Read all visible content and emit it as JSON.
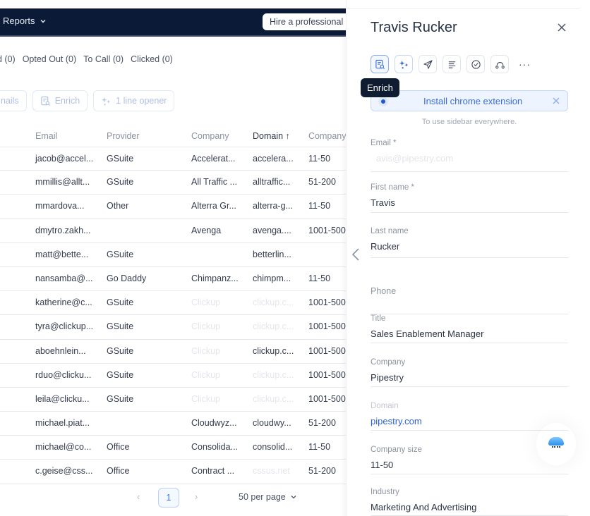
{
  "nav": {
    "reports_label": "Reports",
    "hire_button": "Hire a professional"
  },
  "filters": [
    {
      "label": "d (0)"
    },
    {
      "label": "Opted Out (0)"
    },
    {
      "label": "To Call (0)"
    },
    {
      "label": "Clicked (0)"
    }
  ],
  "actions": {
    "emails_label": "nails",
    "enrich_label": "Enrich",
    "opener_label": "1 line opener"
  },
  "table": {
    "columns": [
      "Email",
      "Provider",
      "Company",
      "Domain ↑",
      "Company"
    ],
    "rows": [
      {
        "email": "jacob@accel...",
        "provider": "GSuite",
        "company": "Accelerat...",
        "domain": "accelera...",
        "size": "11-50"
      },
      {
        "email": "mmillis@allt...",
        "provider": "GSuite",
        "company": "All Traffic ...",
        "domain": "alltraffic...",
        "size": "51-200"
      },
      {
        "email": "mmardova...",
        "provider": "Other",
        "company": "Alterra Gr...",
        "domain": "alterra-g...",
        "size": "11-50"
      },
      {
        "email": "dmytro.zakh...",
        "provider": "",
        "company": "Avenga",
        "domain": "avenga....",
        "size": "1001-500"
      },
      {
        "email": "matt@bette...",
        "provider": "GSuite",
        "company": "",
        "domain": "betterlin...",
        "size": ""
      },
      {
        "email": "nansamba@...",
        "provider": "Go Daddy",
        "company": "Chimpanz...",
        "domain": "chimpm...",
        "size": "11-50"
      },
      {
        "email": "katherine@c...",
        "provider": "GSuite",
        "company": "Clickup",
        "company_faded": true,
        "domain": "clickup.c...",
        "domain_faded": true,
        "size": "1001-500"
      },
      {
        "email": "tyra@clickup...",
        "provider": "GSuite",
        "company": "Clickup",
        "company_faded": true,
        "domain": "clickup.c...",
        "domain_faded": true,
        "size": "1001-500"
      },
      {
        "email": "aboehnlein...",
        "provider": "GSuite",
        "company": "Clickup",
        "company_faded": true,
        "domain": "clickup.c...",
        "size": "1001-500"
      },
      {
        "email": "rduo@clicku...",
        "provider": "GSuite",
        "company": "Clickup",
        "company_faded": true,
        "domain": "clickup.c...",
        "domain_faded": true,
        "size": "1001-500"
      },
      {
        "email": "leila@clicku...",
        "provider": "GSuite",
        "company": "Clickup",
        "company_faded": true,
        "domain": "clickup.c...",
        "domain_faded": true,
        "size": "1001-500"
      },
      {
        "email": "michael.piat...",
        "provider": "",
        "company": "Cloudwyz...",
        "domain": "cloudwy...",
        "size": "51-200"
      },
      {
        "email": "michael@co...",
        "provider": "Office",
        "company": "Consolida...",
        "domain": "consolid...",
        "size": "11-50"
      },
      {
        "email": "c.geise@css...",
        "provider": "Office",
        "company": "Contract ...",
        "domain": "cssus.net",
        "domain_faded": true,
        "size": "51-200"
      }
    ]
  },
  "pagination": {
    "prev": "‹",
    "current_page": "1",
    "next": "›",
    "per_page": "50 per page"
  },
  "panel": {
    "title": "Travis Rucker",
    "tooltip": "Enrich",
    "tools": [
      "enrich",
      "ai-sparkle",
      "send",
      "notes",
      "task",
      "sequence"
    ],
    "more": "···",
    "banner": {
      "text": "Install chrome extension",
      "subtext": "To use sidebar everywhere."
    },
    "fields": [
      {
        "label": "Email *",
        "value": "avis@pipestry.com",
        "placeholder": true
      },
      {
        "label": "First name *",
        "value": "Travis"
      },
      {
        "label": "Last name",
        "value": "Rucker"
      },
      {
        "label": "Phone",
        "value": ""
      },
      {
        "label": "Title",
        "value": "Sales Enablement Manager"
      },
      {
        "label": "Company",
        "value": "Pipestry"
      },
      {
        "label": "Domain",
        "value": "pipestry.com",
        "link": true,
        "label_light": true
      },
      {
        "label": "Company size",
        "value": "11-50"
      },
      {
        "label": "Industry",
        "value": "Marketing And Advertising"
      }
    ]
  },
  "colors": {
    "nav_bg": "#0b1a36",
    "accent": "#3a6fd8",
    "link": "#2e64d1",
    "tooltip_bg": "#0f1b30"
  }
}
